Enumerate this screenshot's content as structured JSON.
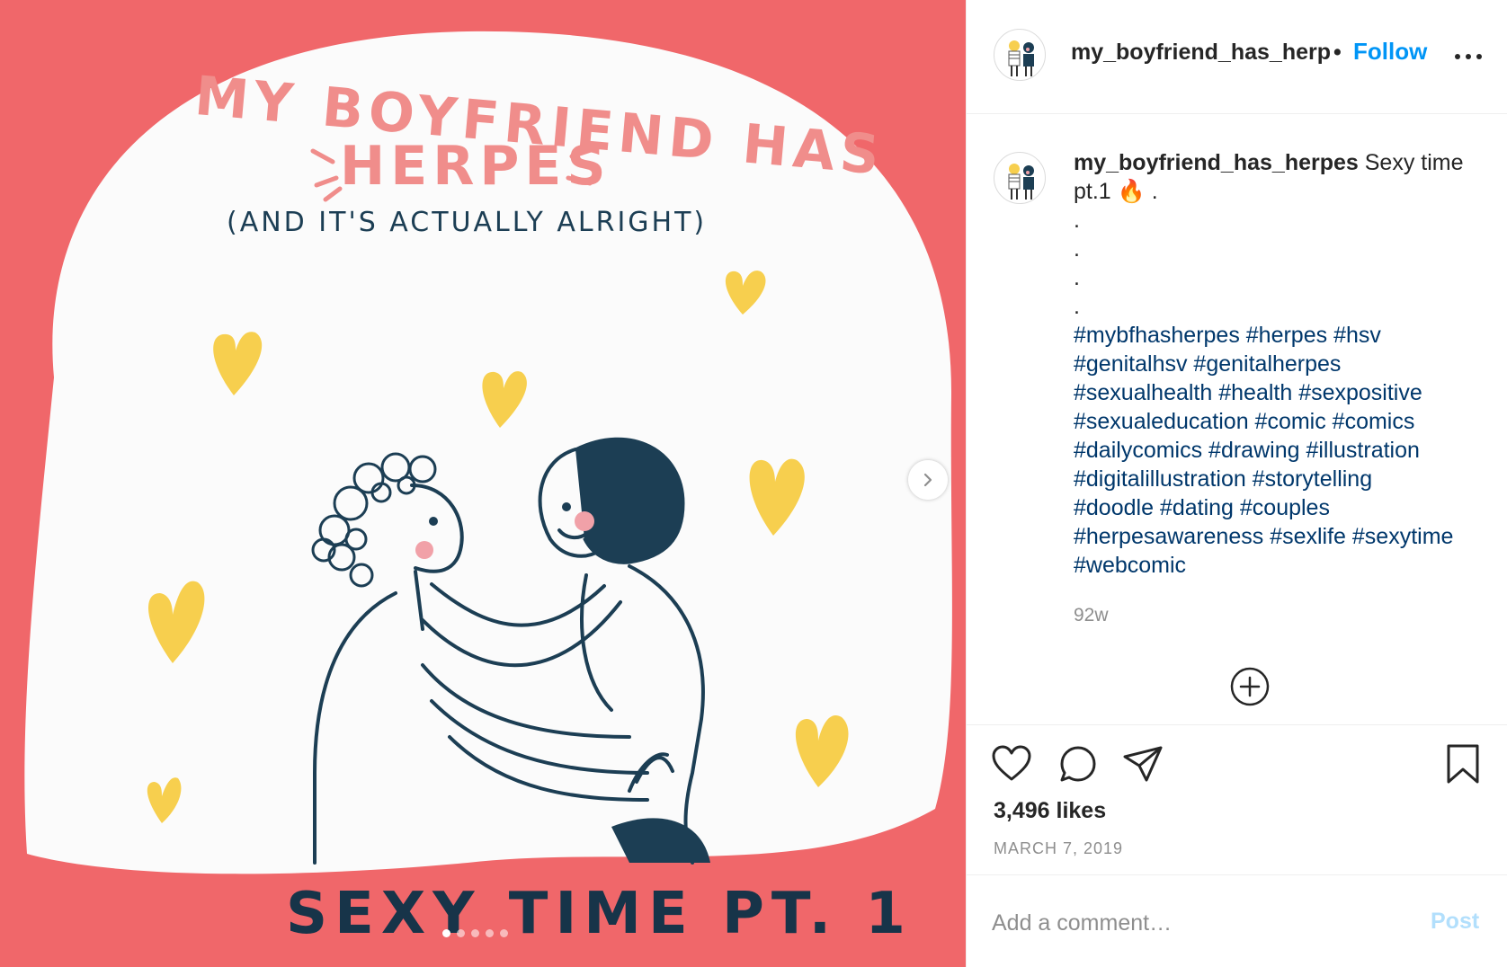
{
  "post": {
    "image_title_line1": "MY BOYFRIEND HAS",
    "image_title_line2": "HERPES",
    "image_subtitle": "(AND IT'S ACTUALLY ALRIGHT)",
    "image_footer": "SEXY TIME PT. 1",
    "carousel": {
      "total_slides": 5,
      "active_slide": 1
    },
    "icons": {
      "next": "chevron-right-icon"
    }
  },
  "header": {
    "username": "my_boyfriend_has_herp",
    "separator": "•",
    "follow_label": "Follow",
    "more_icon": "more-options-icon"
  },
  "caption": {
    "username": "my_boyfriend_has_herpes",
    "text": "Sexy time pt.1",
    "emoji": "🔥",
    "trailing": ".",
    "dot_lines": [
      ".",
      ".",
      ".",
      "."
    ],
    "hashtag_lines": [
      "#mybfhasherpes #herpes #hsv",
      "#genitalhsv #genitalherpes",
      "#sexualhealth #health #sexpositive",
      "#sexualeducation #comic #comics",
      "#dailycomics #drawing #illustration",
      "#digitalillustration #storytelling",
      "#doodle #dating #couples",
      "#herpesawareness #sexlife #sexytime",
      "#webcomic"
    ],
    "age": "92w"
  },
  "actions": {
    "icons": [
      "heart-icon",
      "comment-icon",
      "share-icon",
      "bookmark-icon"
    ],
    "likes": "3,496 likes",
    "date": "MARCH 7, 2019"
  },
  "comment": {
    "placeholder": "Add a comment…",
    "post_label": "Post"
  },
  "colors": {
    "background_pink": "#f0676a",
    "link_blue": "#0095f6",
    "hashtag_blue": "#00376b",
    "heart_yellow": "#f7cf4e",
    "ink_navy": "#1c3e54"
  }
}
